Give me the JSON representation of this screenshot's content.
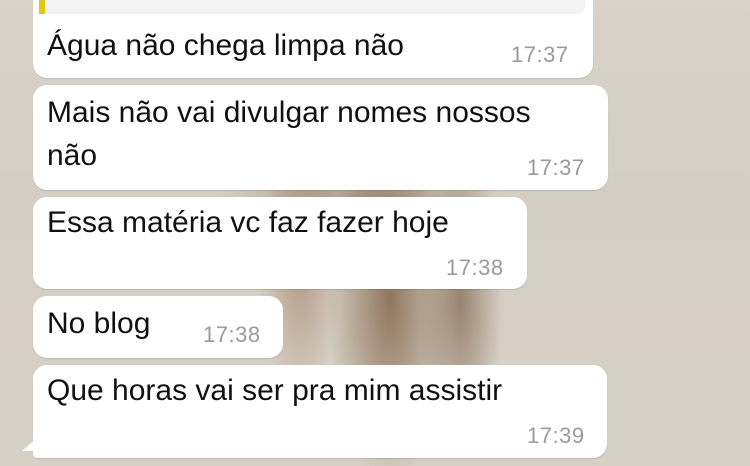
{
  "messages": [
    {
      "text": "Água não chega limpa não",
      "time": "17:37"
    },
    {
      "text_line1": "Mais não vai divulgar nomes nossos",
      "text_line2": "não",
      "time": "17:37"
    },
    {
      "text": "Essa matéria vc faz fazer hoje",
      "time": "17:38"
    },
    {
      "text": "No blog",
      "time": "17:38"
    },
    {
      "text": "Que horas vai ser pra mim assistir",
      "time": "17:39"
    }
  ],
  "colors": {
    "bubble": "#ffffff",
    "text": "#111111",
    "time": "#9a9a9a",
    "quote_bar": "#e3c718"
  }
}
